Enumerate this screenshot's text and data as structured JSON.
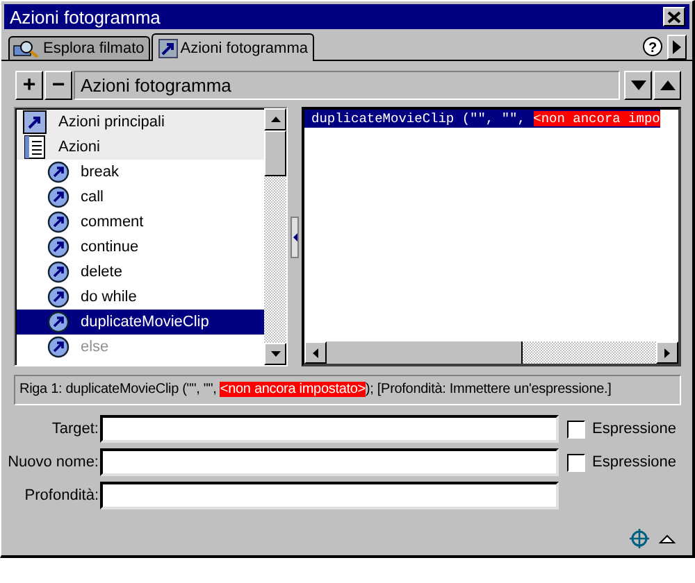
{
  "window": {
    "title": "Azioni fotogramma"
  },
  "tabs": [
    {
      "label": "Esplora filmato",
      "selected": false
    },
    {
      "label": "Azioni fotogramma",
      "selected": true
    }
  ],
  "help": "?",
  "toolbar": {
    "add": "+",
    "remove": "−",
    "title": "Azioni fotogramma"
  },
  "action_list": {
    "groups": [
      {
        "label": "Azioni principali",
        "kind": "book"
      },
      {
        "label": "Azioni",
        "kind": "open-book"
      }
    ],
    "items": [
      {
        "label": "break",
        "selected": false,
        "disabled": false
      },
      {
        "label": "call",
        "selected": false,
        "disabled": false
      },
      {
        "label": "comment",
        "selected": false,
        "disabled": false
      },
      {
        "label": "continue",
        "selected": false,
        "disabled": false
      },
      {
        "label": "delete",
        "selected": false,
        "disabled": false
      },
      {
        "label": "do while",
        "selected": false,
        "disabled": false
      },
      {
        "label": "duplicateMovieClip",
        "selected": true,
        "disabled": false
      },
      {
        "label": "else",
        "selected": false,
        "disabled": true
      }
    ]
  },
  "script": {
    "lines": [
      {
        "selected": true,
        "text": "duplicateMovieClip (\"\", \"\", ",
        "error": "<non ancora impo"
      }
    ]
  },
  "status_line": {
    "before": "Riga 1: duplicateMovieClip (\"\", \"\", ",
    "error": "<non ancora impostato>",
    "after": "); [Profondità: Immettere un'espressione.]"
  },
  "fields": [
    {
      "label": "Target:",
      "expression": {
        "label": "Espressione",
        "checked": false
      }
    },
    {
      "label": "Nuovo nome:",
      "expression": {
        "label": "Espressione",
        "checked": false
      }
    },
    {
      "label": "Profondità:"
    }
  ]
}
